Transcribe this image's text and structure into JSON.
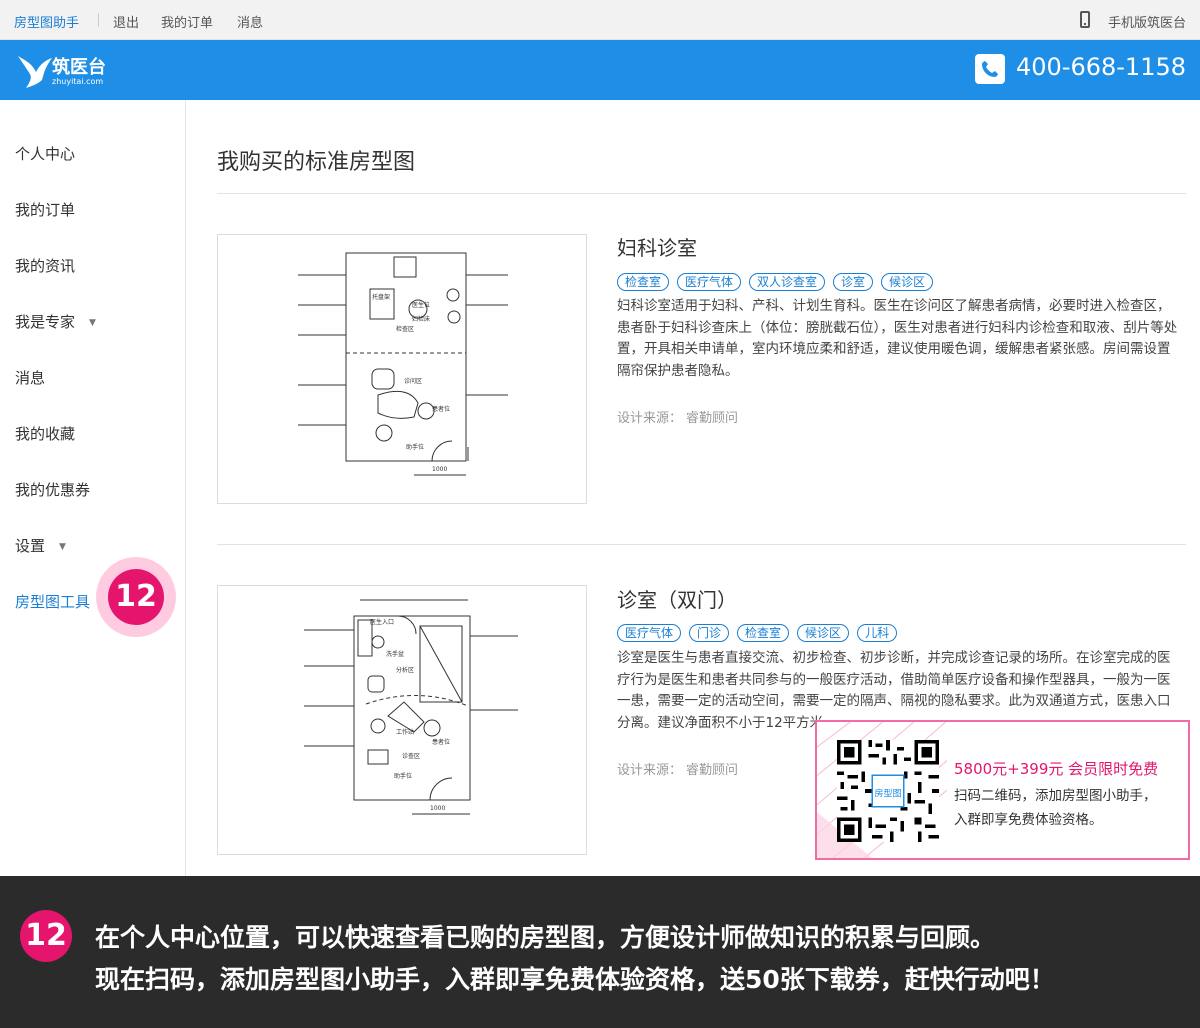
{
  "topbar": {
    "brand": "房型图助手",
    "links": [
      "退出",
      "我的订单",
      "消息"
    ],
    "mobile": "手机版筑医台"
  },
  "header": {
    "logo_text": "筑医台",
    "logo_sub": "zhuyitai.com",
    "hotline": "400-668-1158"
  },
  "sidebar": {
    "items": [
      {
        "label": "个人中心"
      },
      {
        "label": "我的订单"
      },
      {
        "label": "我的资讯"
      },
      {
        "label": "我是专家",
        "caret": "▼"
      },
      {
        "label": "消息"
      },
      {
        "label": "我的收藏"
      },
      {
        "label": "我的优惠券"
      },
      {
        "label": "设置",
        "caret": "▼"
      },
      {
        "label": "房型图工具"
      }
    ],
    "active_index": 8
  },
  "main": {
    "title": "我购买的标准房型图",
    "cards": [
      {
        "title": "妇科诊室",
        "tags": [
          "检查室",
          "医疗气体",
          "双人诊查室",
          "诊室",
          "候诊区"
        ],
        "description": "妇科诊室适用于妇科、产科、计划生育科。医生在诊问区了解患者病情，必要时进入检查区，患者卧于妇科诊查床上（体位：膀胱截石位），医生对患者进行妇科内诊检查和取液、刮片等处置，开具相关申请单，室内环境应柔和舒适，建议使用暖色调，缓解患者紧张感。房间需设置隔帘保护患者隐私。",
        "source_label": "设计来源：",
        "source": "睿勤顾问",
        "plan_labels": [
          "检查区",
          "诊问区",
          "医生位",
          "患者位",
          "助手位",
          "托盘架",
          "妇检床",
          "1000"
        ]
      },
      {
        "title": "诊室（双门）",
        "tags": [
          "医疗气体",
          "门诊",
          "检查室",
          "候诊区",
          "儿科"
        ],
        "description": "诊室是医生与患者直接交流、初步检查、初步诊断，并完成诊查记录的场所。在诊室完成的医疗行为是医生和患者共同参与的一般医疗活动，借助简单医疗设备和操作型器具，一般为一医一患，需要一定的活动空间，需要一定的隔声、隔视的隐私要求。此为双通道方式，医患入口分离。建议净面积不小于12平方米。",
        "source_label": "设计来源：",
        "source": "睿勤顾问",
        "plan_labels": [
          "分析区",
          "诊查区",
          "医生入口",
          "洗手盆",
          "工作站",
          "患者位",
          "助手位",
          "1000"
        ]
      }
    ]
  },
  "promo": {
    "headline": "5800元+399元 会员限时免费",
    "line1": "扫码二维码，添加房型图小助手，",
    "line2": "入群即享免费体验资格。",
    "qr_label": "房型图"
  },
  "badge": {
    "number": "12"
  },
  "banner": {
    "number": "12",
    "line1": "在个人中心位置，可以快速查看已购的房型图，方便设计师做知识的积累与回顾。",
    "line2": "现在扫码，添加房型图小助手，入群即享免费体验资格，送50张下载券，赶快行动吧！"
  },
  "colors": {
    "brand_blue": "#1e8ee6",
    "link_blue": "#1a7fd4",
    "accent_pink": "#e5156e",
    "banner_bg": "#2b2b2b"
  }
}
